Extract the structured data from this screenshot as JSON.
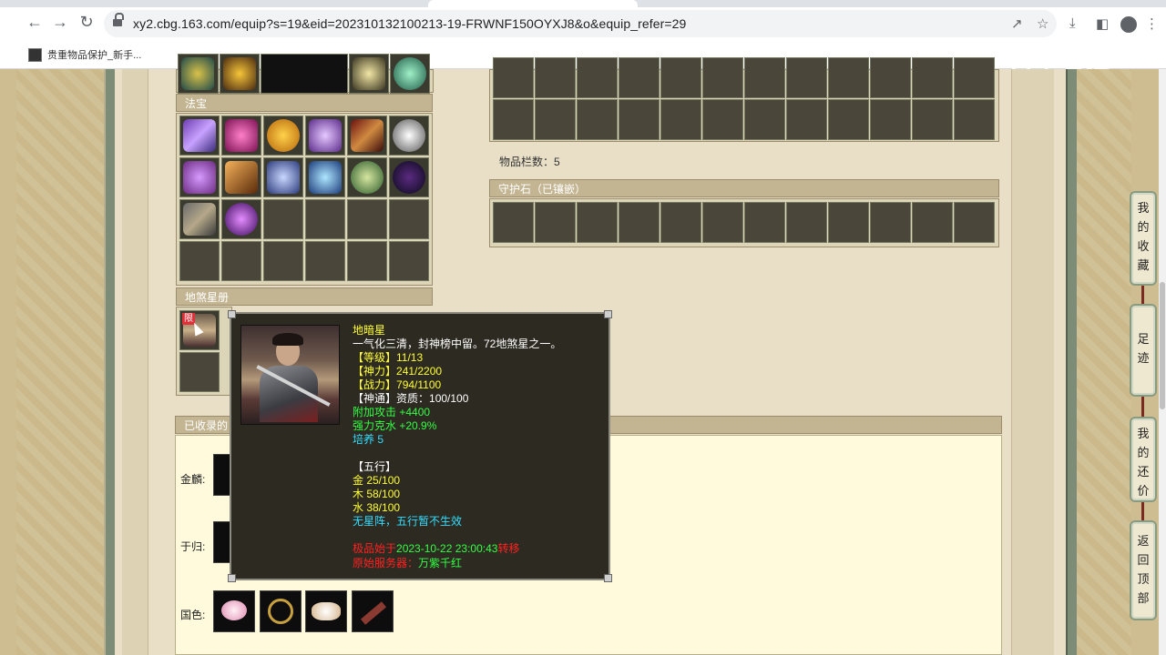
{
  "browser": {
    "url": "xy2.cbg.163.com/equip?s=19&eid=202310132100213-19-FRWNF150OYXJ8&o&equip_refer=29",
    "bookmark": "贵重物品保护_新手..."
  },
  "watermark": "CC直播",
  "sections": {
    "fabao_title": "法宝",
    "disha_title": "地煞星册",
    "collected_title": "已收录的",
    "guard_title": "守护石（已镶嵌）",
    "item_count_label": "物品栏数：5",
    "limit_badge": "限"
  },
  "tooltip": {
    "name": "地暗星",
    "desc": "一气化三清，封神榜中留。72地煞星之一。",
    "level_label": "【等级】",
    "level_value": "11/13",
    "shenli_label": "【神力】",
    "shenli_value": "241/2200",
    "zhanli_label": "【战力】",
    "zhanli_value": "794/1100",
    "shentong_label": "【神通】",
    "shentong_value": "资质：100/100",
    "bonus1": "附加攻击 +4400",
    "bonus2": "强力克水 +20.9%",
    "cultivate": "培养 5",
    "wuxing_title": "【五行】",
    "gold": "金 25/100",
    "wood": "木 58/100",
    "water": "水 38/100",
    "no_array": "无星阵，五行暂不生效",
    "line1_red_a": "极品始于",
    "line1_green": "2023-10-22 23:00:43",
    "line1_red_b": "转移",
    "line2_red": "原始服务器：",
    "line2_green": "万紫千红"
  },
  "lower": {
    "row1_label": "金麟:",
    "row2_label": "于归:",
    "row3_label": "国色:"
  },
  "side_menu": [
    {
      "label": [
        "我",
        "的",
        "收",
        "藏"
      ]
    },
    {
      "label": [
        "足",
        "迹"
      ]
    },
    {
      "label": [
        "我",
        "的",
        "还",
        "价"
      ]
    },
    {
      "label": [
        "返",
        "回",
        "顶",
        "部"
      ]
    }
  ],
  "colors": {
    "tooltip_bg": "#2d2a21",
    "yellow": "#ffff33",
    "green": "#33ff44",
    "cyan": "#33ddff",
    "red": "#ff2222"
  }
}
